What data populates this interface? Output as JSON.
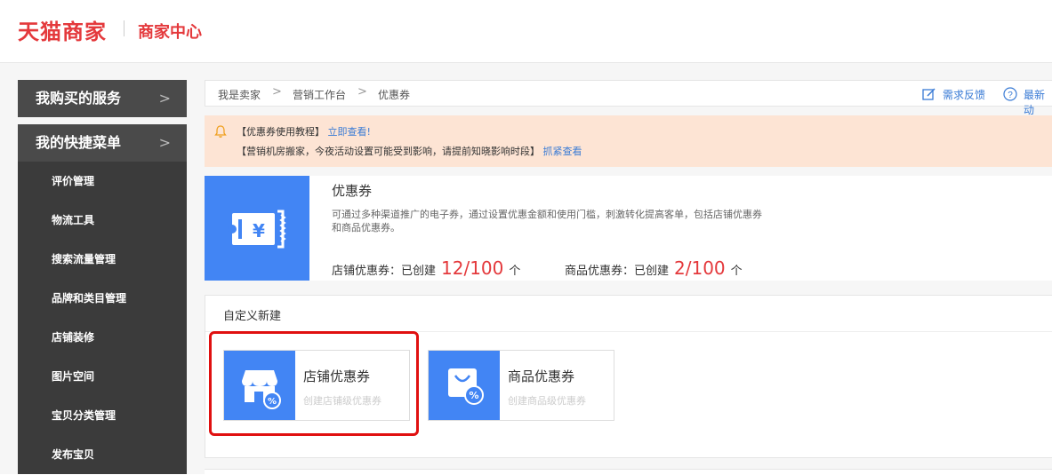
{
  "header": {
    "brand": "天猫商家",
    "subtitle": "商家中心"
  },
  "sidebar": {
    "sections": [
      {
        "label": "我购买的服务",
        "chevron": ">"
      },
      {
        "label": "我的快捷菜单",
        "chevron": ">"
      }
    ],
    "items": [
      {
        "label": "评价管理"
      },
      {
        "label": "物流工具"
      },
      {
        "label": "搜索流量管理"
      },
      {
        "label": "品牌和类目管理"
      },
      {
        "label": "店铺装修"
      },
      {
        "label": "图片空间"
      },
      {
        "label": "宝贝分类管理"
      },
      {
        "label": "发布宝贝"
      }
    ]
  },
  "breadcrumb": {
    "items": [
      "我是卖家",
      "营销工作台",
      "优惠券"
    ],
    "separator": ">",
    "feedback": "需求反馈",
    "latest": "最新动"
  },
  "notice": {
    "line1_prefix": "【优惠券使用教程】",
    "line1_link": "立即查看!",
    "line2_prefix": "【营销机房搬家，今夜活动设置可能受到影响，请提前知晓影响时段】",
    "line2_link": "抓紧查看"
  },
  "coupon": {
    "title": "优惠券",
    "description": "可通过多种渠道推广的电子券，通过设置优惠金额和使用门槛，刺激转化提高客单，包括店铺优惠券和商品优惠券。",
    "shop_stat_label": "店铺优惠券：已创建",
    "shop_stat_value": "12/100",
    "product_stat_label": "商品优惠券：已创建",
    "product_stat_value": "2/100",
    "unit": "个"
  },
  "custom": {
    "title": "自定义新建",
    "cards": [
      {
        "title": "店铺优惠券",
        "subtitle": "创建店铺级优惠券",
        "icon": "shop-coupon-icon"
      },
      {
        "title": "商品优惠券",
        "subtitle": "创建商品级优惠券",
        "icon": "product-coupon-icon"
      }
    ]
  },
  "colors": {
    "brand_red": "#e4393c",
    "accent_blue": "#4285f4",
    "link_blue": "#3a7bd5",
    "notice_bg": "#fde4d4",
    "sidebar_dark": "#3b3b3b",
    "highlight_red": "#e01010"
  }
}
